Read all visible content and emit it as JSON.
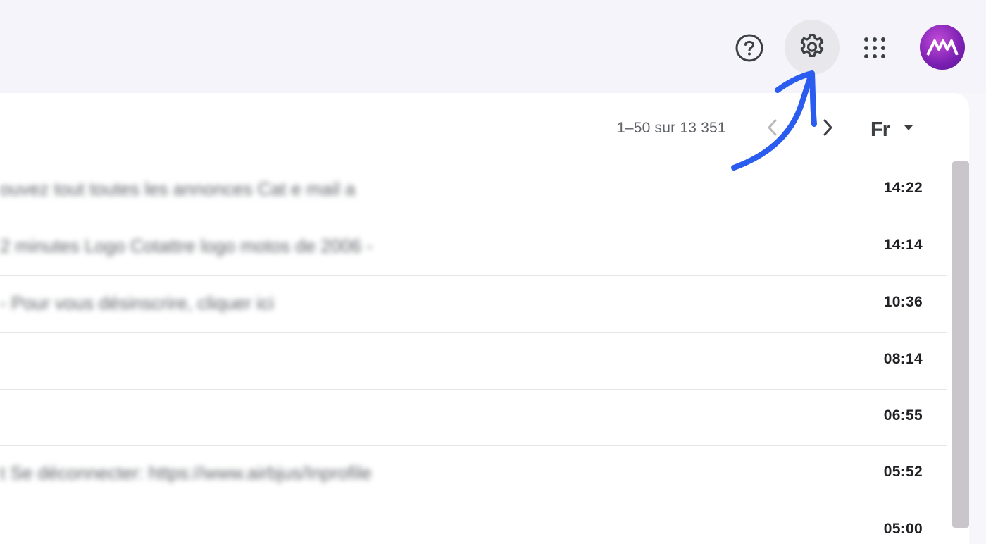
{
  "header": {
    "help_icon": "help-circle-icon",
    "settings_icon": "gear-icon",
    "apps_icon": "apps-grid-icon",
    "avatar_icon": "account-avatar"
  },
  "toolbar": {
    "count_text": "1–50 sur 13 351",
    "lang_label": "Fr"
  },
  "emails": [
    {
      "snippet": "ouvez tout toutes les annonces Cat e mail a",
      "time": "14:22"
    },
    {
      "snippet": "2 minutes Logo Cotattre logo motos de 2006 -",
      "time": "14:14"
    },
    {
      "snippet": "- Pour vous désinscrire, cliquer ici",
      "time": "10:36"
    },
    {
      "snippet": "",
      "time": "08:14"
    },
    {
      "snippet": "",
      "time": "06:55"
    },
    {
      "snippet": "t Se déconnecter: https://www.airbjus/Inprofile",
      "time": "05:52"
    },
    {
      "snippet": "",
      "time": "05:00"
    }
  ],
  "colors": {
    "annotation_arrow": "#2a5cf0",
    "avatar_bg": "#8a2bc2"
  }
}
